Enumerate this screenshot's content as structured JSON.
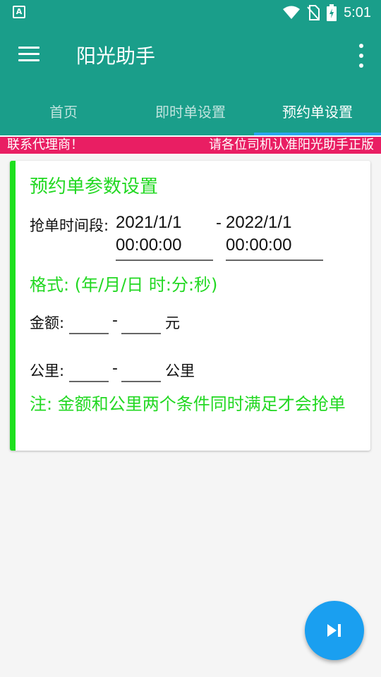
{
  "status_bar": {
    "time": "5:01",
    "icons": [
      "app-notification-icon",
      "wifi-icon",
      "no-sim-icon",
      "battery-charging-icon"
    ]
  },
  "app_bar": {
    "title": "阳光助手",
    "icons": [
      "menu-icon",
      "more-vert-icon"
    ]
  },
  "tabs": [
    {
      "label": "首页",
      "active": false
    },
    {
      "label": "即时单设置",
      "active": false
    },
    {
      "label": "预约单设置",
      "active": true
    }
  ],
  "marquee": {
    "text": "联系代理商！",
    "text2": "请各位司机认准阳光助手正版"
  },
  "card": {
    "title": "预约单参数设置",
    "time_range": {
      "label": "抢单时间段:",
      "start": "2021/1/1\n00:00:00",
      "start_line1": "2021/1/1",
      "start_line2": "00:00:00",
      "separator": "-",
      "end_line1": "2022/1/1",
      "end_line2": "00:00:00"
    },
    "format_note": "格式: (年/月/日 时:分:秒)",
    "amount": {
      "label": "金额:",
      "min": "",
      "separator": "-",
      "max": "",
      "unit": "元"
    },
    "distance": {
      "label": "公里:",
      "min": "",
      "separator": "-",
      "max": "",
      "unit": "公里"
    },
    "note": "注: 金额和公里两个条件同时满足才会抢单"
  },
  "fab": {
    "icon": "skip-next-icon"
  },
  "colors": {
    "primary": "#1a9e8a",
    "accent": "#2aa6f0",
    "marquee_bg": "#e91e63",
    "green_text": "#22d822",
    "fab": "#1a9ff0"
  }
}
